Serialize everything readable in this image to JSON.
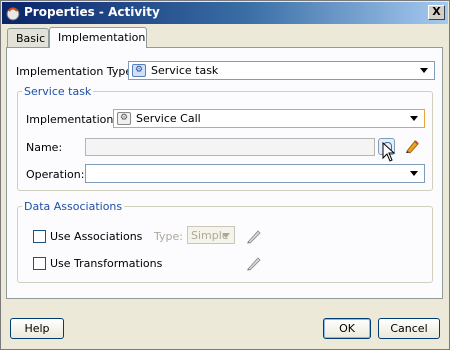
{
  "window": {
    "title": "Properties - Activity",
    "close_label": "X"
  },
  "tabs": [
    {
      "label": "Basic",
      "active": false
    },
    {
      "label": "Implementation",
      "active": true
    }
  ],
  "implementation_type": {
    "label": "Implementation Type:",
    "value": "Service task",
    "icon": "service-task-icon"
  },
  "service_task": {
    "legend": "Service task",
    "implementation_label": "Implementation:",
    "implementation_value": "Service Call",
    "implementation_icon": "gear-icon",
    "name_label": "Name:",
    "name_value": "",
    "operation_label": "Operation:",
    "operation_value": ""
  },
  "data_associations": {
    "legend": "Data Associations",
    "use_associations_label": "Use Associations",
    "use_associations_checked": false,
    "type_label": "Type:",
    "type_value": "Simple",
    "use_transformations_label": "Use Transformations",
    "use_transformations_checked": false
  },
  "footer": {
    "help_label": "Help",
    "ok_label": "OK",
    "cancel_label": "Cancel"
  },
  "colors": {
    "accent": "#1f4fa8",
    "focus_border": "#e8a33c"
  }
}
